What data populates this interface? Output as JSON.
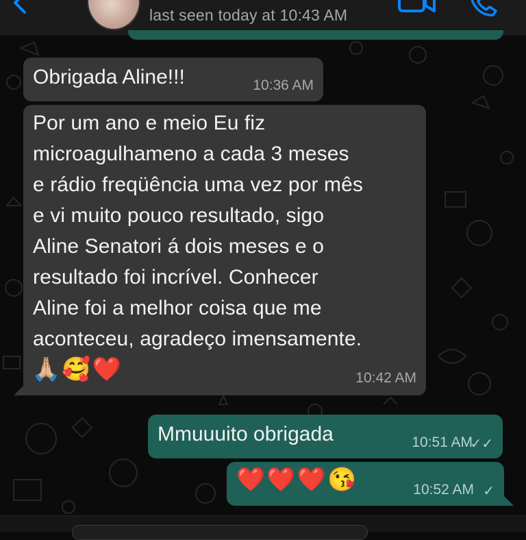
{
  "header": {
    "last_seen": "last seen today at 10:43 AM",
    "icons": [
      "back-icon",
      "avatar",
      "video-call-icon",
      "phone-call-icon"
    ],
    "accent_color": "#0a84ff"
  },
  "messages": [
    {
      "direction": "incoming",
      "text": "Obrigada Aline!!!",
      "time": "10:36 AM"
    },
    {
      "direction": "incoming",
      "lines": [
        "Por um ano e meio Eu fiz",
        "microagulhameno a cada 3 meses",
        "e rádio freqüência uma vez por mês",
        "e vi muito pouco resultado, sigo",
        "Aline Senatori á dois meses e o",
        "resultado foi incrível. Conhecer",
        "Aline foi a melhor coisa que me",
        "aconteceu, agradeço imensamente."
      ],
      "emojis": "🙏🏼🥰❤️",
      "time": "10:42 AM"
    },
    {
      "direction": "outgoing",
      "text": "Mmuuuito obrigada",
      "time": "10:51 AM",
      "status": "✓✓"
    },
    {
      "direction": "outgoing",
      "emojis": "❤️❤️❤️😘",
      "time": "10:52 AM",
      "status": "✓"
    }
  ],
  "colors": {
    "incoming_bubble": "#373737",
    "outgoing_bubble": "#1f6157",
    "background": "#0b0b0b"
  }
}
